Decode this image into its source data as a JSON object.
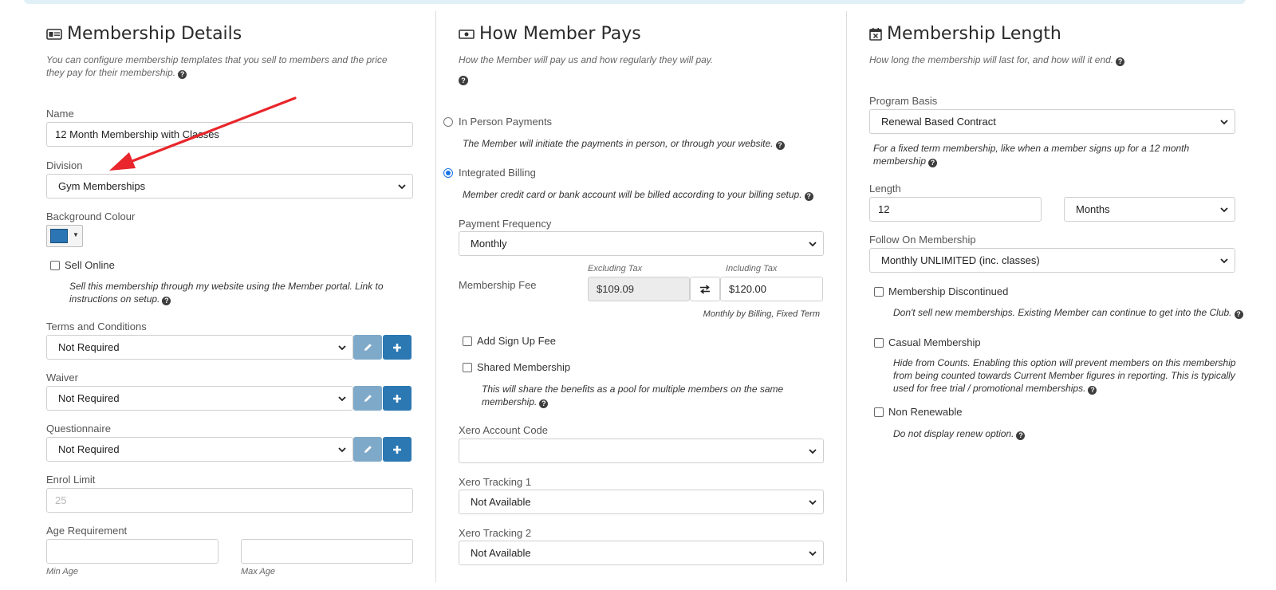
{
  "details": {
    "heading": "Membership Details",
    "description": "You can configure membership templates that you sell to members and the price they pay for their membership.",
    "name_label": "Name",
    "name_value": "12 Month Membership with Classes",
    "division_label": "Division",
    "division_value": "Gym Memberships",
    "bg_colour_label": "Background Colour",
    "bg_colour_value": "#2b75b4",
    "sell_online_label": "Sell Online",
    "sell_online_hint": "Sell this membership through my website using the Member portal. Link to instructions on setup.",
    "terms_label": "Terms and Conditions",
    "terms_value": "Not Required",
    "waiver_label": "Waiver",
    "waiver_value": "Not Required",
    "questionnaire_label": "Questionnaire",
    "questionnaire_value": "Not Required",
    "enrol_limit_label": "Enrol Limit",
    "enrol_limit_placeholder": "25",
    "age_label": "Age Requirement",
    "min_age_label": "Min Age",
    "max_age_label": "Max Age"
  },
  "pays": {
    "heading": "How Member Pays",
    "description": "How the Member will pay us and how regularly they will pay.",
    "in_person_label": "In Person Payments",
    "in_person_hint": "The Member will initiate the payments in person, or through your website.",
    "integrated_label": "Integrated Billing",
    "integrated_hint": "Member credit card or bank account will be billed according to your billing setup.",
    "frequency_label": "Payment Frequency",
    "frequency_value": "Monthly",
    "fee_label": "Membership Fee",
    "excl_tax_label": "Excluding Tax",
    "excl_tax_value": "$109.09",
    "incl_tax_label": "Including Tax",
    "incl_tax_value": "$120.00",
    "fee_note": "Monthly by Billing, Fixed Term",
    "signup_fee_label": "Add Sign Up Fee",
    "shared_label": "Shared Membership",
    "shared_hint": "This will share the benefits as a pool for multiple members on the same membership.",
    "xero_code_label": "Xero Account Code",
    "xero_code_value": "",
    "xero_t1_label": "Xero Tracking 1",
    "xero_t1_value": "Not Available",
    "xero_t2_label": "Xero Tracking 2",
    "xero_t2_value": "Not Available"
  },
  "length": {
    "heading": "Membership Length",
    "description": "How long the membership will last for, and how will it end.",
    "basis_label": "Program Basis",
    "basis_value": "Renewal Based Contract",
    "basis_hint": "For a fixed term membership, like when a member signs up for a 12 month membership",
    "length_label": "Length",
    "length_value": "12",
    "length_unit": "Months",
    "follow_label": "Follow On Membership",
    "follow_value": "Monthly UNLIMITED (inc. classes)",
    "discontinued_label": "Membership Discontinued",
    "discontinued_hint": "Don't sell new memberships. Existing Member can continue to get into the Club.",
    "casual_label": "Casual Membership",
    "casual_hint": "Hide from Counts. Enabling this option will prevent members on this membership from being counted towards Current Member figures in reporting. This is typically used for free trial / promotional memberships.",
    "non_renewable_label": "Non Renewable",
    "non_renewable_hint": "Do not display renew option."
  },
  "colors": {
    "annotation_arrow": "#e8262b",
    "primary_button": "#2b78b2",
    "light_button": "#7fa9c9",
    "radio_selected": "#1a73e8"
  }
}
